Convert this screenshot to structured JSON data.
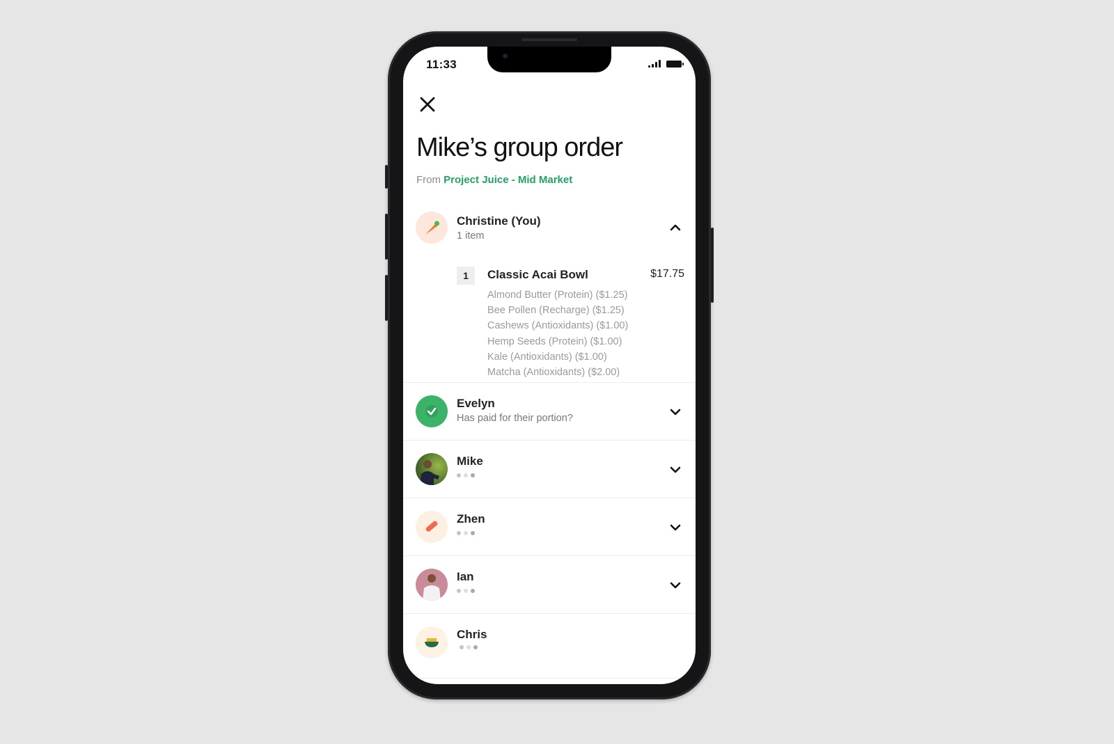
{
  "status_bar": {
    "time": "11:33"
  },
  "header": {
    "close_icon": "close-icon",
    "title": "Mike’s group order",
    "from_label": "From",
    "restaurant": "Project Juice - Mid Market"
  },
  "colors": {
    "accent_green": "#1fa464",
    "paid_green": "#3bb46a"
  },
  "members": [
    {
      "name": "Christine (You)",
      "subtitle": "1 item",
      "avatar": "carrot-icon",
      "expanded": true,
      "items": [
        {
          "quantity": "1",
          "name": "Classic Acai Bowl",
          "price": "$17.75",
          "options": [
            "Almond Butter (Protein) ($1.25)",
            "Bee Pollen (Recharge) ($1.25)",
            "Cashews (Antioxidants) ($1.00)",
            "Hemp Seeds (Protein) ($1.00)",
            "Kale (Antioxidants) ($1.00)",
            "Matcha (Antioxidants) ($2.00)"
          ]
        }
      ]
    },
    {
      "name": "Evelyn",
      "subtitle": "Has paid for their portion?",
      "avatar": "check-icon",
      "expanded": false
    },
    {
      "name": "Mike",
      "subtitle": "",
      "avatar": "photo-avatar",
      "status": "loading-dots",
      "expanded": false
    },
    {
      "name": "Zhen",
      "subtitle": "",
      "avatar": "bacon-icon",
      "status": "loading-dots",
      "expanded": false
    },
    {
      "name": "Ian",
      "subtitle": "",
      "avatar": "photo-avatar",
      "status": "loading-dots",
      "expanded": false
    },
    {
      "name": "Chris",
      "subtitle": "",
      "avatar": "bowl-icon",
      "status": "loading-dots"
    }
  ]
}
